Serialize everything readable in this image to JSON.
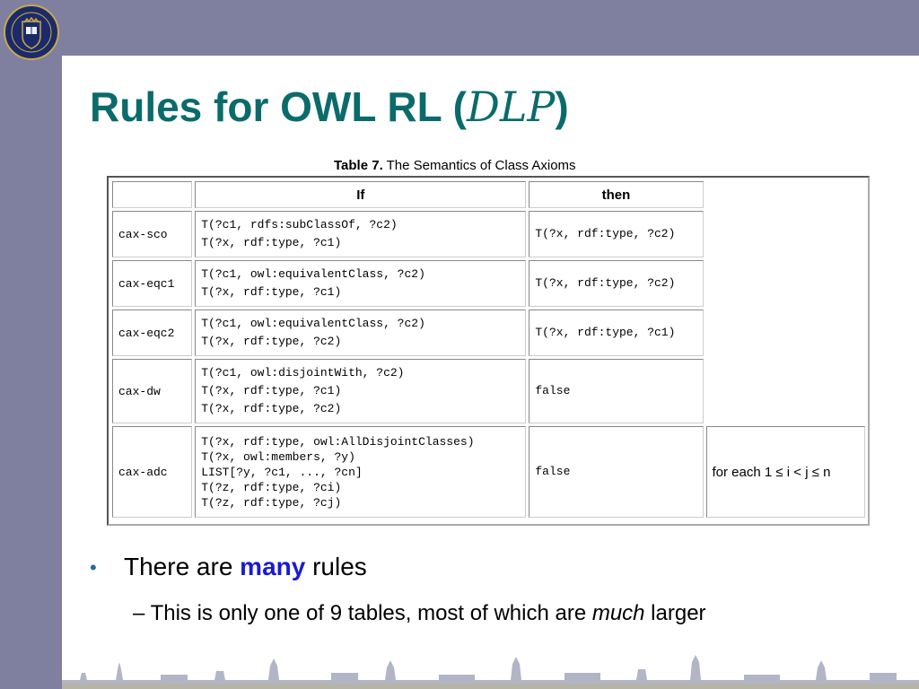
{
  "title": {
    "main": "Rules for OWL RL (",
    "acronym": "DLP",
    "close": ")"
  },
  "table": {
    "caption_bold": "Table 7.",
    "caption_rest": " The Semantics of Class Axioms",
    "headers": {
      "if": "If",
      "then": "then"
    },
    "rows": [
      {
        "name": "cax-sco",
        "if_lines": [
          "T(?c1, rdfs:subClassOf, ?c2)",
          "T(?x, rdf:type, ?c1)"
        ],
        "then": "T(?x, rdf:type, ?c2)"
      },
      {
        "name": "cax-eqc1",
        "if_lines": [
          "T(?c1, owl:equivalentClass, ?c2)",
          "T(?x, rdf:type, ?c1)"
        ],
        "then": "T(?x, rdf:type, ?c2)"
      },
      {
        "name": "cax-eqc2",
        "if_lines": [
          "T(?c1, owl:equivalentClass, ?c2)",
          "T(?x, rdf:type, ?c2)"
        ],
        "then": "T(?x, rdf:type, ?c1)"
      },
      {
        "name": "cax-dw",
        "if_lines": [
          "T(?c1, owl:disjointWith, ?c2)",
          "T(?x, rdf:type, ?c1)",
          "T(?x, rdf:type, ?c2)"
        ],
        "then": "false"
      },
      {
        "name": "cax-adc",
        "if_lines": [
          "T(?x, rdf:type, owl:AllDisjointClasses)",
          "T(?x, owl:members, ?y)",
          "LIST[?y, ?c1, ..., ?cn]",
          "T(?z, rdf:type, ?ci)",
          "T(?z, rdf:type, ?cj)"
        ],
        "then": "false",
        "condition": "for each 1 ≤ i < j ≤ n"
      }
    ]
  },
  "bullets": {
    "b1_pre": "There are ",
    "b1_em": "many",
    "b1_post": " rules",
    "b2_dash": "–",
    "b2_pre": "This is only one of 9 tables, most of which are ",
    "b2_em": "much",
    "b2_post": " larger"
  },
  "colors": {
    "frame": "#7f80a0",
    "title": "#0b6b6b",
    "emphasis": "#1a1ad6"
  },
  "icons": {
    "logo": "university-crest-icon",
    "footer": "city-skyline-decoration"
  }
}
